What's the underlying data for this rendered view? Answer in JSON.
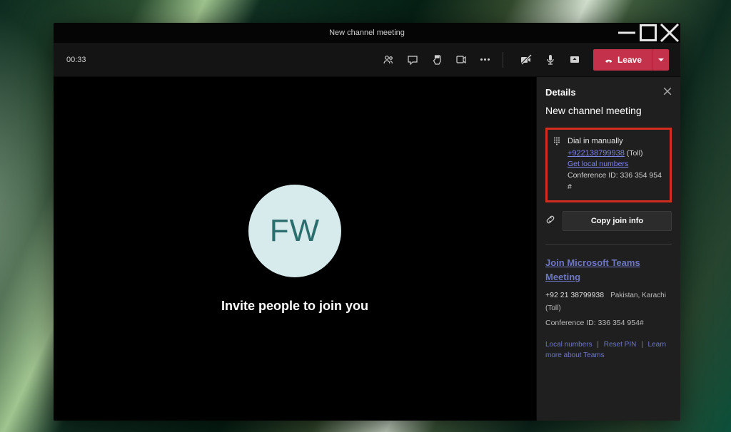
{
  "window": {
    "title": "New channel meeting"
  },
  "toolbar": {
    "timer": "00:33",
    "leave_label": "Leave"
  },
  "stage": {
    "avatar_initials": "FW",
    "invite_text": "Invite people to join you"
  },
  "panel": {
    "title": "Details",
    "meeting_name": "New channel meeting",
    "dial_in": {
      "heading": "Dial in manually",
      "phone_link": "+922138799938",
      "toll_suffix": " (Toll)",
      "get_local": "Get local numbers",
      "conference_id_label": "Conference ID: 336 354 954 #"
    },
    "copy_join_label": "Copy join info",
    "join": {
      "join_link": "Join Microsoft Teams Meeting",
      "phone": "+92 21 38799938",
      "location": "Pakistan, Karachi (Toll)",
      "conference_id_label": "Conference ID: 336 354 954#"
    },
    "footer": {
      "local_numbers": "Local numbers",
      "reset_pin": "Reset PIN",
      "learn_more": "Learn more about Teams"
    }
  }
}
